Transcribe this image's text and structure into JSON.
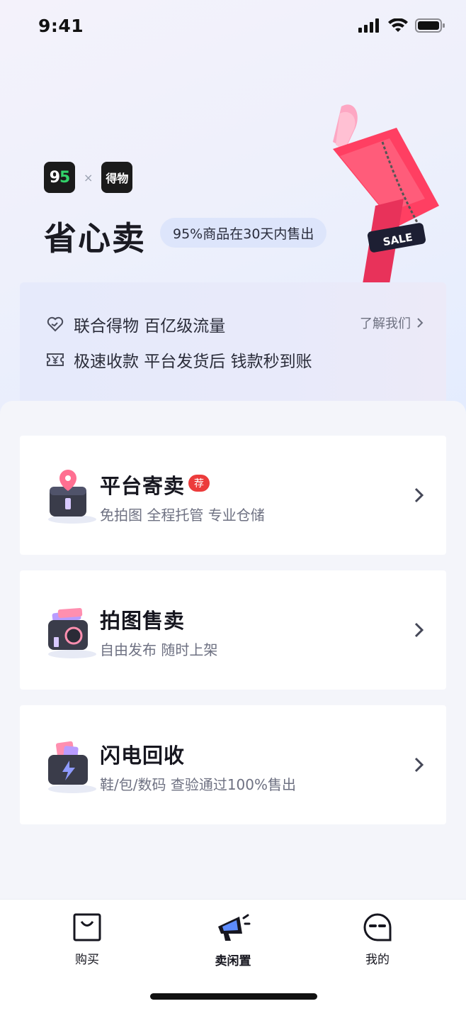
{
  "status_bar": {
    "time": "9:41"
  },
  "hero": {
    "logo_95": "95",
    "logo_x": "×",
    "logo_dewu": "得物",
    "title": "省心卖",
    "tag": "95%商品在30天内售出",
    "sale_sign": "SALE"
  },
  "info_card": {
    "rows": [
      {
        "icon": "handshake-heart-icon",
        "text": "联合得物 百亿级流量"
      },
      {
        "icon": "yuan-ticket-icon",
        "text": "极速收款 平台发货后 钱款秒到账"
      }
    ],
    "learn_more": "了解我们"
  },
  "options": [
    {
      "icon": "consignment-box-icon",
      "title": "平台寄卖",
      "badge": "荐",
      "subtitle": "免拍图 全程托管 专业仓储"
    },
    {
      "icon": "camera-photo-icon",
      "title": "拍图售卖",
      "badge": "",
      "subtitle": "自由发布 随时上架"
    },
    {
      "icon": "lightning-recycle-icon",
      "title": "闪电回收",
      "badge": "",
      "subtitle": "鞋/包/数码 查验通过100%售出"
    }
  ],
  "tabbar": {
    "items": [
      {
        "icon": "shopping-bag-icon",
        "label": "购买",
        "active": false
      },
      {
        "icon": "megaphone-icon",
        "label": "卖闲置",
        "active": true
      },
      {
        "icon": "profile-face-icon",
        "label": "我的",
        "active": false
      }
    ]
  },
  "colors": {
    "accent_red": "#ec3b3b",
    "brand_green": "#32d36a",
    "text_dark": "#16161f"
  }
}
